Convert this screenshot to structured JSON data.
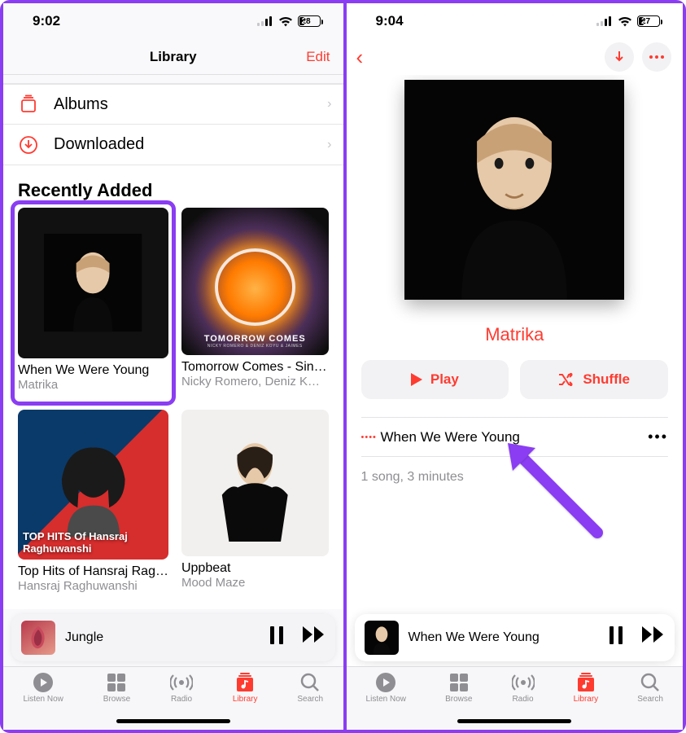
{
  "left": {
    "status": {
      "time": "9:02",
      "battery": "28"
    },
    "nav": {
      "title": "Library",
      "edit": "Edit"
    },
    "rows": {
      "albums": "Albums",
      "downloaded": "Downloaded"
    },
    "section_title": "Recently Added",
    "albums": [
      {
        "title": "When We Were Young",
        "artist": "Matrika"
      },
      {
        "title": "Tomorrow Comes - Sin…",
        "artist": "Nicky Romero, Deniz K…",
        "cover_text": "TOMORROW COMES",
        "cover_sub": "NICKY ROMERO & DENIZ KOYU & JAIMES"
      },
      {
        "title": "Top Hits of Hansraj Rag…",
        "artist": "Hansraj Raghuwanshi",
        "cover_text": "TOP HITS Of Hansraj Raghuwanshi"
      },
      {
        "title": "Uppbeat",
        "artist": "Mood Maze"
      }
    ],
    "mini": {
      "title": "Jungle"
    },
    "tabs": [
      "Listen Now",
      "Browse",
      "Radio",
      "Library",
      "Search"
    ]
  },
  "right": {
    "status": {
      "time": "9:04",
      "battery": "27"
    },
    "artist": "Matrika",
    "play_label": "Play",
    "shuffle_label": "Shuffle",
    "track": "When We Were Young",
    "summary": "1 song, 3 minutes",
    "mini": {
      "title": "When We Were Young"
    },
    "tabs": [
      "Listen Now",
      "Browse",
      "Radio",
      "Library",
      "Search"
    ]
  }
}
